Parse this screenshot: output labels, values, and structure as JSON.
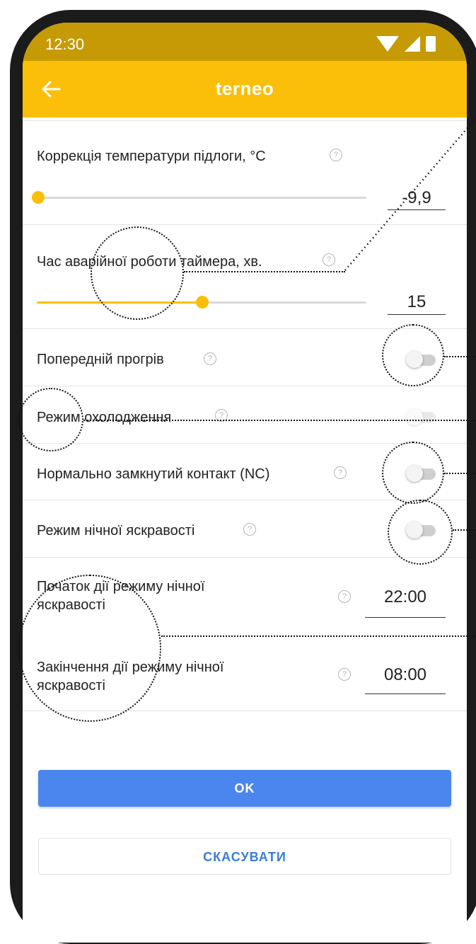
{
  "status_bar": {
    "time": "12:30",
    "icons": [
      "wifi-icon",
      "signal-icon",
      "battery-icon"
    ]
  },
  "app_bar": {
    "title": "terneo",
    "back_icon": "arrow-left-icon"
  },
  "settings": {
    "floor_correction": {
      "label": "Коррекція температури  підлоги, °C",
      "value": "-9,9",
      "slider_fraction": 0.0
    },
    "emergency_timer": {
      "label": "Час аварійної  роботи таймера, хв.",
      "value": "15",
      "slider_fraction": 0.5
    },
    "preheat": {
      "label": "Попередній прогрів",
      "state": "off"
    },
    "cooling_mode": {
      "label": "Режим охолодження",
      "state": "off",
      "disabled": true
    },
    "nc_contact": {
      "label": "Нормально замкнутий контакт (NC)",
      "state": "off"
    },
    "night_brightness": {
      "label": "Режим нічної яскравості",
      "state": "off"
    },
    "night_start": {
      "label": "Початок дії режиму нічної яскравості",
      "value": "22:00"
    },
    "night_end": {
      "label": "Закінчення дії режиму нічної яскравості",
      "value": "08:00"
    }
  },
  "buttons": {
    "ok": "OK",
    "cancel": "СКАСУВАТИ"
  },
  "colors": {
    "accent": "#fbbf0a",
    "status_bar": "#c59a04",
    "primary_button": "#4a86ee",
    "cancel_text": "#3a7bdc"
  }
}
